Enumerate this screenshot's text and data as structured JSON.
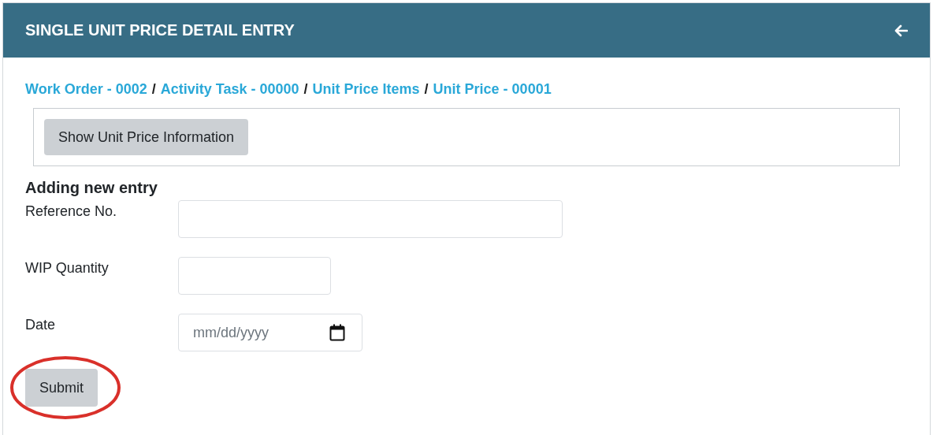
{
  "header": {
    "title": "SINGLE UNIT PRICE DETAIL ENTRY"
  },
  "breadcrumb": [
    {
      "kind": "link",
      "label": "Work Order - 0002"
    },
    {
      "kind": "separator",
      "label": "/"
    },
    {
      "kind": "link",
      "label": "Activity Task - 00000"
    },
    {
      "kind": "separator",
      "label": "/"
    },
    {
      "kind": "link",
      "label": "Unit Price Items"
    },
    {
      "kind": "separator",
      "label": "/"
    },
    {
      "kind": "link",
      "label": "Unit Price - 00001"
    }
  ],
  "info_button": {
    "label": "Show Unit Price Information"
  },
  "form": {
    "heading": "Adding new entry",
    "fields": [
      {
        "kind": "text",
        "label": "Reference No."
      },
      {
        "kind": "number",
        "label": "WIP Quantity"
      },
      {
        "kind": "date",
        "label": "Date",
        "placeholder": "mm/dd/yyyy"
      }
    ],
    "submit": {
      "label": "Submit",
      "circled": true
    }
  }
}
